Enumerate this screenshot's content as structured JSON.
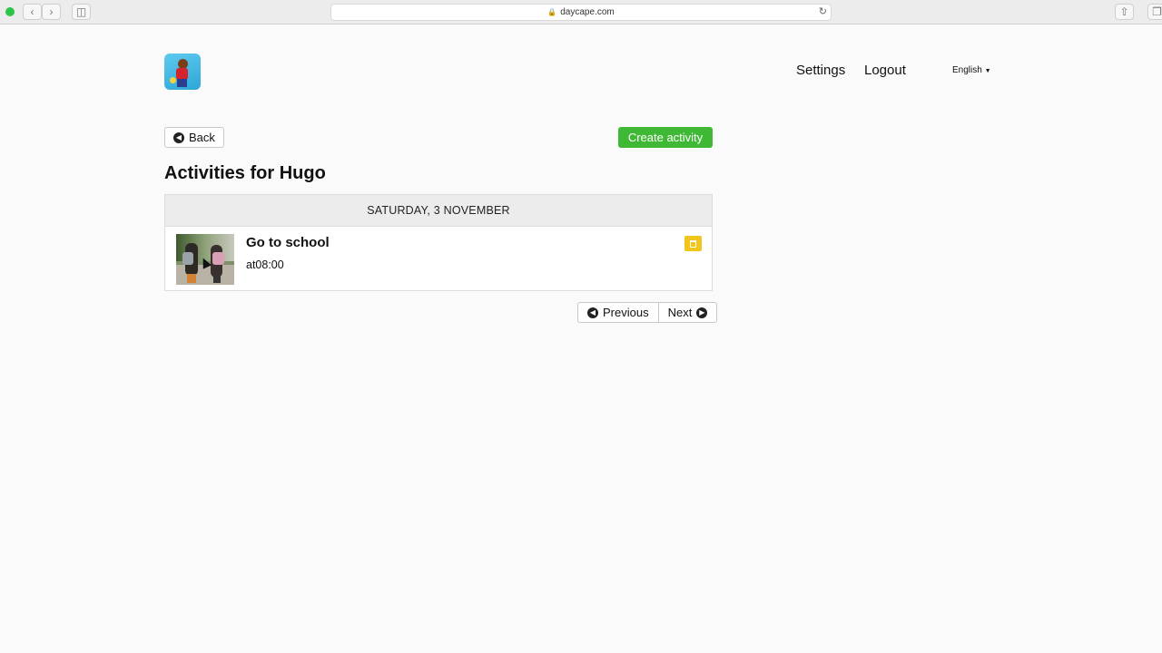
{
  "browser": {
    "url": "daycape.com"
  },
  "header": {
    "nav": [
      {
        "label": "Settings"
      },
      {
        "label": "Logout"
      }
    ],
    "language": "English"
  },
  "actions": {
    "back_label": "Back",
    "create_label": "Create activity"
  },
  "page": {
    "title": "Activities for Hugo"
  },
  "day": {
    "heading": "SATURDAY, 3 NOVEMBER",
    "activities": [
      {
        "name": "Go to school",
        "time": "at08:00"
      }
    ]
  },
  "pager": {
    "previous_label": "Previous",
    "next_label": "Next"
  },
  "colors": {
    "create_button": "#3fb935",
    "delete_button": "#f2c51c"
  },
  "icons": [
    "arrow-left-circle-icon",
    "arrow-right-circle-icon",
    "trash-icon",
    "lock-icon",
    "reload-icon"
  ]
}
